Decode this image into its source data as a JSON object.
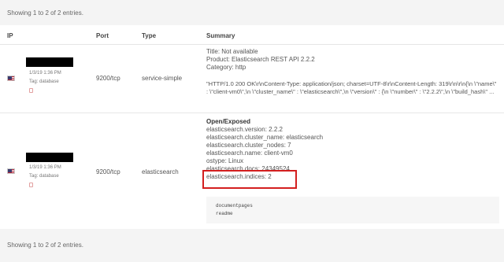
{
  "info": {
    "showing": "Showing 1 to 2 of 2 entries."
  },
  "columns": [
    "IP",
    "Port",
    "Type",
    "Summary"
  ],
  "rows": [
    {
      "date": "1/3/19 1:36 PM",
      "tag": "Tag: database",
      "port": "9200/tcp",
      "type": "service-simple",
      "summary": [
        "Title: Not available",
        "Product: Elasticsearch REST API 2.2.2",
        "Category: http"
      ],
      "response": "\"HTTP/1.0 200 OK\\r\\nContent-Type: application/json; charset=UTF-8\\r\\nContent-Length: 319\\r\\n\\r\\n{\\n \\\"name\\\" : \\\"client-vm0\\\",\\n \\\"cluster_name\\\" : \\\"elasticsearch\\\",\\n \\\"version\\\" : {\\n \\\"number\\\" : \\\"2.2.2\\\",\\n \\\"build_hash\\\" ..."
    },
    {
      "date": "1/3/19 1:36 PM",
      "tag": "Tag: database",
      "port": "9200/tcp",
      "type": "elasticsearch",
      "heading": "Open/Exposed",
      "summary": [
        "elasticsearch.version: 2.2.2",
        "elasticsearch.cluster_name: elasticsearch",
        "elasticsearch.cluster_nodes: 7",
        "elasticsearch.name: client-vm0",
        "ostype: Linux",
        "elasticsearch.docs: 24349524",
        "elasticsearch.indices: 2"
      ],
      "code": [
        "documentpages",
        "readme"
      ]
    }
  ],
  "colors": {
    "highlight": "#d31f1f",
    "band": "#f4f4f4"
  },
  "icons": {
    "flag": "us-flag-icon",
    "tag": "tag-icon"
  }
}
